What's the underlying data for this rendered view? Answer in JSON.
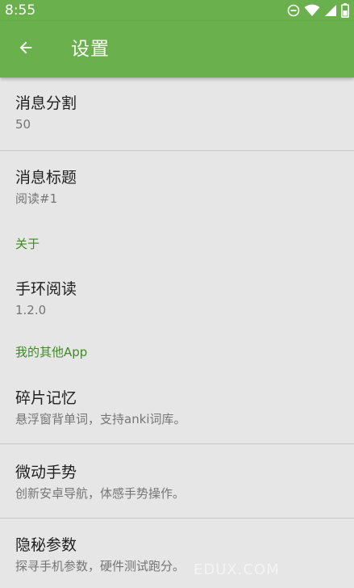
{
  "status_bar": {
    "time": "8:55",
    "icons": [
      "do-not-disturb-icon",
      "wifi-icon",
      "signal-icon",
      "battery-icon"
    ],
    "color": "#6ab04c"
  },
  "app_bar": {
    "title": "设置",
    "back_icon": "arrow-back-icon",
    "color": "#6ab04c"
  },
  "preferences": {
    "message_split": {
      "title": "消息分割",
      "value": "50"
    },
    "message_title": {
      "title": "消息标题",
      "value": "阅读#1"
    },
    "category_about": "关于",
    "band_reader": {
      "title": "手环阅读",
      "version": "1.2.0"
    },
    "category_other_apps": "我的其他App",
    "other_apps": [
      {
        "title": "碎片记忆",
        "summary": "悬浮窗背单词，支持anki词库。"
      },
      {
        "title": "微动手势",
        "summary": "创新安卓导航，体感手势操作。"
      },
      {
        "title": "隐秘参数",
        "summary": "探寻手机参数，硬件测试跑分。"
      }
    ]
  },
  "accent_color": "#3d8b22",
  "watermark": "EDUX.COM"
}
